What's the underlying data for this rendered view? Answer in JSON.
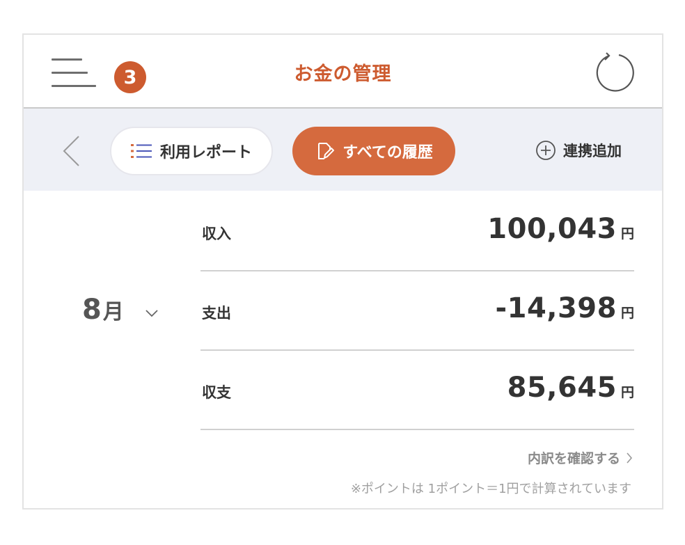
{
  "header": {
    "title": "お金の管理",
    "notification_count": "3",
    "menu_icon": "hamburger-menu-icon",
    "refresh_icon": "refresh-icon"
  },
  "tabs": {
    "report_label": "利用レポート",
    "history_label": "すべての履歴",
    "add_link_label": "連携追加",
    "active": "history"
  },
  "summary": {
    "month_number": "8",
    "month_unit": "月",
    "rows": [
      {
        "label": "収入",
        "amount": "100,043",
        "unit": "円"
      },
      {
        "label": "支出",
        "amount": "-14,398",
        "unit": "円"
      },
      {
        "label": "収支",
        "amount": "85,645",
        "unit": "円"
      }
    ],
    "details_link": "内訳を確認する",
    "note": "※ポイントは 1ポイント＝1円で計算されています"
  },
  "colors": {
    "accent": "#cd5b2f",
    "active_tab": "#d56a3e",
    "tabbar_bg": "#eef0f6",
    "list_icon": "#4b57b8"
  }
}
